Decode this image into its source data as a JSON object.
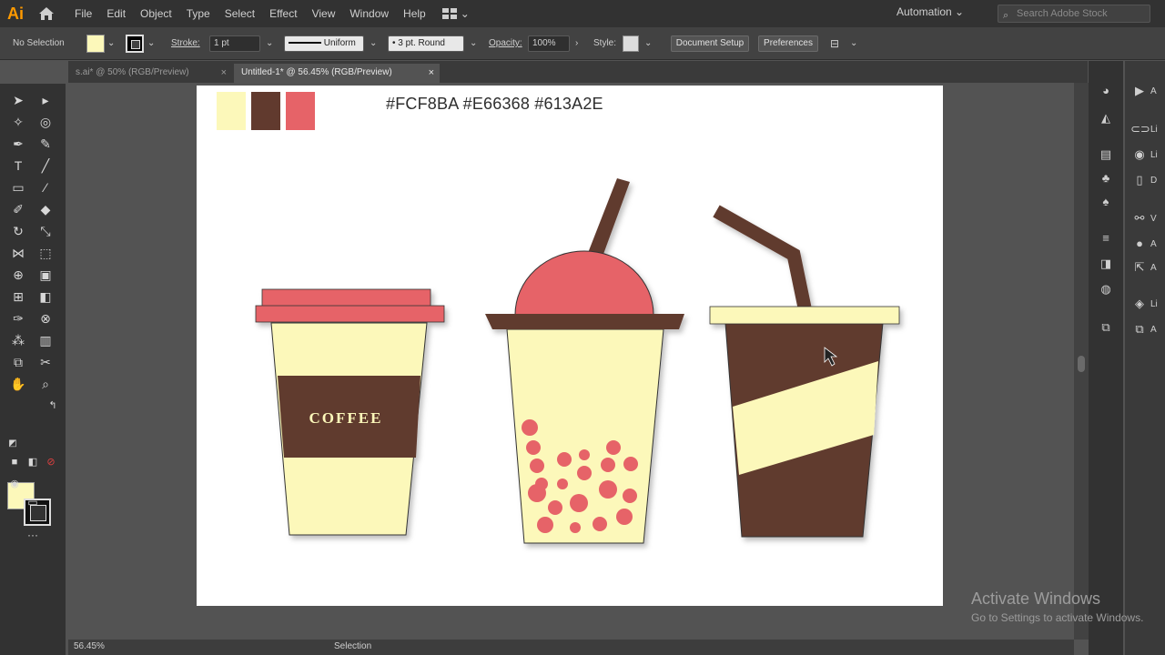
{
  "app": {
    "logo": "Ai"
  },
  "menu": [
    "File",
    "Edit",
    "Object",
    "Type",
    "Select",
    "Effect",
    "View",
    "Window",
    "Help"
  ],
  "workspace": "Automation",
  "stock_search_placeholder": "Search Adobe Stock",
  "control_bar": {
    "selection": "No Selection",
    "stroke_label": "Stroke:",
    "stroke_value": "1 pt",
    "profile": "Uniform",
    "brush": "3 pt. Round",
    "opacity_label": "Opacity:",
    "opacity_value": "100%",
    "style_label": "Style:",
    "document_setup": "Document Setup",
    "preferences": "Preferences",
    "fill_color": "#FCF8BA"
  },
  "tabs": [
    {
      "label": "s.ai* @ 50% (RGB/Preview)",
      "active": false
    },
    {
      "label": "Untitled-1* @ 56.45% (RGB/Preview)",
      "active": true
    }
  ],
  "artboard": {
    "hex_codes": "#FCF8BA  #E66368 #613A2E",
    "swatches": [
      "#FCF8BA",
      "#613A2E",
      "#E66368"
    ],
    "coffee_label": "COFFEE"
  },
  "colors": {
    "cream": "#FCF8BA",
    "coral": "#E66368",
    "brown": "#613A2E"
  },
  "status": {
    "zoom": "56.45%",
    "mode": "Selection"
  },
  "watermark": {
    "title": "Activate Windows",
    "subtitle": "Go to Settings to activate Windows."
  },
  "right_dock_labels": [
    "A",
    "Li",
    "Li",
    "D",
    "V",
    "A",
    "A",
    "Li",
    "A"
  ]
}
